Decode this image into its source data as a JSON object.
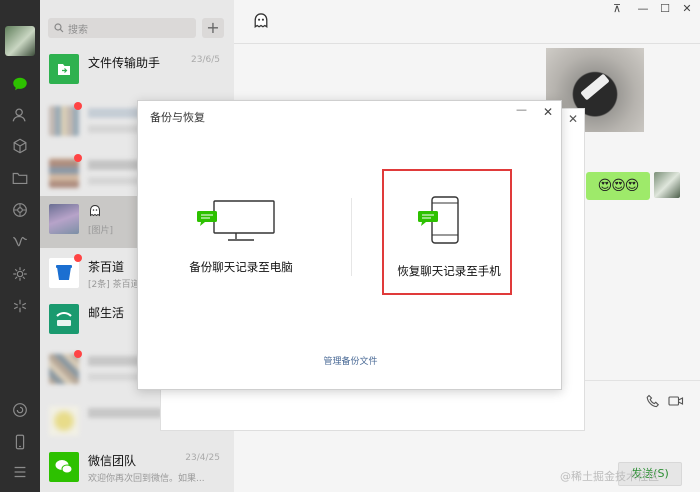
{
  "app": {
    "accent": "#2dc100",
    "rail_bg": "#2e2e2e"
  },
  "search": {
    "placeholder": "搜索",
    "add_label": "+"
  },
  "sessions": [
    {
      "name": "文件传输助手",
      "message": "",
      "time": "23/6/5",
      "avatar": "file-transfer-icon",
      "unread": false
    },
    {
      "name": "",
      "message": "",
      "time": "",
      "avatar": "group-avatar",
      "unread": true
    },
    {
      "name": "",
      "message": "",
      "time": "",
      "avatar": "group-avatar",
      "unread": true
    },
    {
      "name": "",
      "message": "[图片]",
      "time": "",
      "avatar": "contact-avatar",
      "unread": false
    },
    {
      "name": "茶百道",
      "message": "[2条] 茶百道",
      "time": "",
      "avatar": "chabaidao-avatar",
      "unread": true
    },
    {
      "name": "邮生活",
      "message": "",
      "time": "",
      "avatar": "post-life-avatar",
      "unread": false
    },
    {
      "name": "",
      "message": "",
      "time": "",
      "avatar": "group-avatar",
      "unread": true
    },
    {
      "name": "",
      "message": "",
      "time": "",
      "avatar": "contact-avatar",
      "unread": false
    },
    {
      "name": "微信团队",
      "message": "欢迎你再次回到微信。如果...",
      "time": "23/4/25",
      "avatar": "wechat-team-icon",
      "unread": false
    }
  ],
  "chat": {
    "bubble": "😍😍😍",
    "send_label": "发送(S)"
  },
  "dialog": {
    "title": "备份与恢复",
    "backup_to_pc": "备份聊天记录至电脑",
    "restore_to_phone": "恢复聊天记录至手机",
    "manage_link": "管理备份文件"
  },
  "window": {
    "minimize": "—",
    "maximize": "☐",
    "close": "✕",
    "pin": "⊼"
  },
  "watermark": "@稀土掘金技术社区"
}
